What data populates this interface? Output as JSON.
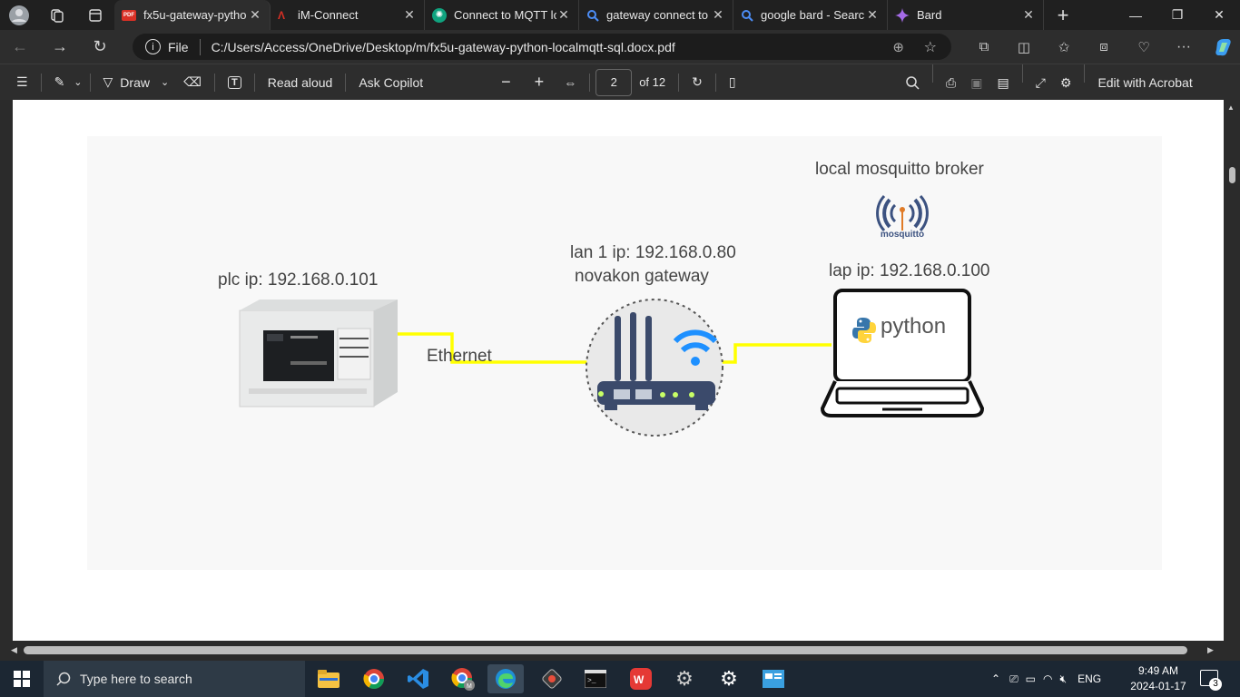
{
  "browser": {
    "tabs": [
      {
        "title": "fx5u-gateway-pytho",
        "icon": "pdf-icon",
        "active": true
      },
      {
        "title": "iM-Connect",
        "icon": "im-connect-icon"
      },
      {
        "title": "Connect to MQTT lo",
        "icon": "chatgpt-icon"
      },
      {
        "title": "gateway connect to",
        "icon": "search-icon"
      },
      {
        "title": "google bard - Searc",
        "icon": "search-icon"
      },
      {
        "title": "Bard",
        "icon": "bard-icon"
      }
    ],
    "file_label": "File",
    "url": "C:/Users/Access/OneDrive/Desktop/m/fx5u-gateway-python-localmqtt-sql.docx.pdf"
  },
  "pdf_toolbar": {
    "draw_label": "Draw",
    "read_aloud_label": "Read aloud",
    "ask_copilot_label": "Ask Copilot",
    "page_number": "2",
    "page_total": "of 12",
    "edit_label": "Edit with Acrobat"
  },
  "figure": {
    "broker_label": "local mosquitto broker",
    "mosquitto_text": "mosquitto",
    "plc_label": "plc ip: 192.168.0.101",
    "ethernet_label": "Ethernet",
    "gateway_ip_label": "lan 1 ip: 192.168.0.80",
    "gateway_name_label": "novakon gateway",
    "laptop_label": "lap ip: 192.168.0.100",
    "python_text": "python",
    "colors": {
      "cable": "#ffff00",
      "mosquitto": "#3c5280",
      "mosquitto_accent": "#e07b27",
      "wifi": "#1e90ff",
      "router": "#3b4a6b"
    }
  },
  "taskbar": {
    "search_placeholder": "Type here to search",
    "language": "ENG",
    "time": "9:49 AM",
    "date": "2024-01-17",
    "notification_count": "3"
  }
}
